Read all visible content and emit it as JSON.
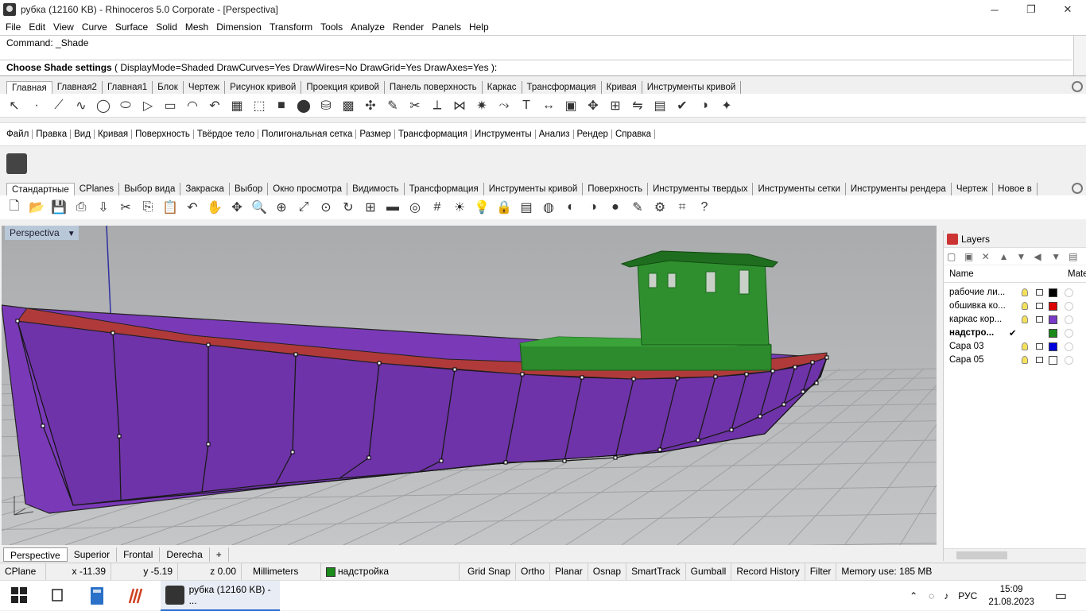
{
  "window": {
    "title": "рубка (12160 KB) - Rhinoceros  5.0 Corporate - [Perspectiva]",
    "minimize": "─",
    "restore": "❐",
    "close": "✕"
  },
  "menubar": [
    "File",
    "Edit",
    "View",
    "Curve",
    "Surface",
    "Solid",
    "Mesh",
    "Dimension",
    "Transform",
    "Tools",
    "Analyze",
    "Render",
    "Panels",
    "Help"
  ],
  "command": {
    "history": "Command: _Shade",
    "prompt_bold": "Choose Shade settings",
    "prompt_options": " ( DisplayMode=Shaded  DrawCurves=Yes  DrawWires=No  DrawGrid=Yes  DrawAxes=Yes ):"
  },
  "toolbar_tabs_1": [
    "Главная",
    "Главная2",
    "Главная1",
    "Блок",
    "Чертеж",
    "Рисунок кривой",
    "Проекция кривой",
    "Панель поверхность",
    "Каркас",
    "Трансформация",
    "Кривая",
    "Инструменты кривой"
  ],
  "toolbar_tabs_1_active": "Главная",
  "toolbar_icons_1": [
    "select-icon",
    "point-icon",
    "polyline-icon",
    "curve-icon",
    "circle-icon",
    "ellipse-icon",
    "polygon-icon",
    "rectangle-icon",
    "arc-icon",
    "fillet-icon",
    "surface-icon",
    "extrude-icon",
    "box-icon",
    "boolean-icon",
    "cylinder-icon",
    "mesh-icon",
    "transform-icon",
    "edit-icon",
    "trim-icon",
    "split-icon",
    "join-icon",
    "explode-icon",
    "offset-icon",
    "text-icon",
    "dimension-icon",
    "group-icon",
    "move-icon",
    "array-icon",
    "mirror-icon",
    "layers-icon",
    "check-icon",
    "render-icon",
    "paint-icon"
  ],
  "menu_row_2": [
    "Файл",
    "Правка",
    "Вид",
    "Кривая",
    "Поверхность",
    "Твёрдое тело",
    "Полигональная сетка",
    "Размер",
    "Трансформация",
    "Инструменты",
    "Анализ",
    "Рендер",
    "Справка"
  ],
  "toolbar_tabs_2": [
    "Стандартные",
    "CPlanes",
    "Выбор вида",
    "Закраска",
    "Выбор",
    "Окно просмотра",
    "Видимость",
    "Трансформация",
    "Инструменты кривой",
    "Поверхность",
    "Инструменты твердых",
    "Инструменты сетки",
    "Инструменты рендера",
    "Чертеж",
    "Новое в"
  ],
  "toolbar_tabs_2_active": "Стандартные",
  "toolbar_icons_2": [
    "new-icon",
    "open-icon",
    "save-icon",
    "print-icon",
    "import-icon",
    "cut-icon",
    "copy-icon",
    "paste-icon",
    "undo-icon",
    "pan-icon",
    "move-view-icon",
    "zoom-icon",
    "zoom-window-icon",
    "zoom-extents-icon",
    "zoom-selected-icon",
    "rotate-view-icon",
    "four-views-icon",
    "car-icon",
    "cplane-icon",
    "grid-icon",
    "sun-icon",
    "light-icon",
    "lock-icon",
    "layer-icon",
    "color-icon",
    "shade-icon",
    "render-icon",
    "material-icon",
    "pen-icon",
    "settings-icon",
    "options-icon",
    "help-icon"
  ],
  "viewport": {
    "name": "Perspectiva"
  },
  "view_tabs": [
    "Perspective",
    "Superior",
    "Frontal",
    "Derecha",
    "+"
  ],
  "view_tabs_active": "Perspective",
  "layers": {
    "title": "Layers",
    "col_name": "Name",
    "col_material": "Mater",
    "rows": [
      {
        "name": "рабочие ли...",
        "color": "#000000",
        "current": false
      },
      {
        "name": "обшивка ко...",
        "color": "#dd0000",
        "current": false
      },
      {
        "name": "каркас кор...",
        "color": "#7a3ac8",
        "current": false
      },
      {
        "name": "надстро...",
        "color": "#1a8a1a",
        "current": true
      },
      {
        "name": "Capa 03",
        "color": "#0000dd",
        "current": false
      },
      {
        "name": "Capa 05",
        "color": "#ffffff",
        "current": false
      }
    ],
    "current_mark": "✔"
  },
  "status": {
    "cplane": "CPlane",
    "x": "x -11.39",
    "y": "y -5.19",
    "z": "z 0.00",
    "units": "Millimeters",
    "layer": "надстройка",
    "layer_color": "#1a8a1a",
    "grid_snap": "Grid Snap",
    "ortho": "Ortho",
    "planar": "Planar",
    "osnap": "Osnap",
    "smarttrack": "SmartTrack",
    "gumball": "Gumball",
    "record_history": "Record History",
    "filter": "Filter",
    "memory": "Memory use: 185 MB"
  },
  "taskbar": {
    "app_label": "рубка (12160 KB) - ...",
    "lang": "РУС",
    "time": "15:09",
    "date": "21.08.2023"
  }
}
